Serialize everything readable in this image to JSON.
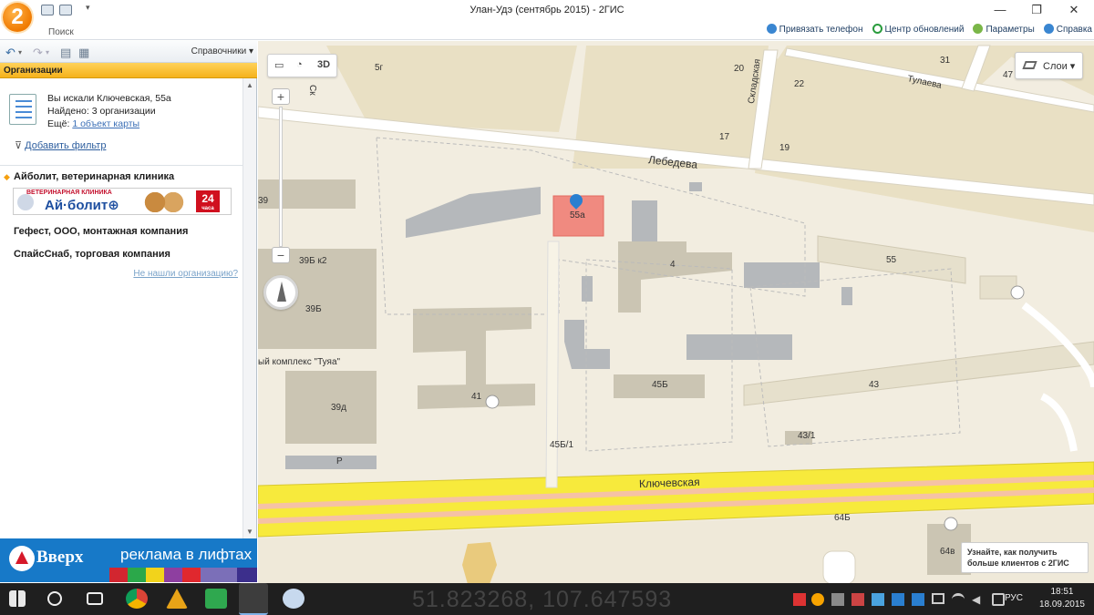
{
  "window": {
    "title": "Улан-Удэ (сентябрь 2015) - 2ГИС",
    "logo_text": "2",
    "search_tab": "Поиск",
    "minimize": "—",
    "restore": "❐",
    "close": "✕"
  },
  "top_links": {
    "link_phone": "Привязать телефон",
    "update_center": "Центр обновлений",
    "settings": "Параметры",
    "help": "Справка"
  },
  "left_panel": {
    "handbooks_label": "Справочники ▾",
    "section_title": "Организации",
    "search_info": {
      "query_line": "Вы искали Ключевская, 55а",
      "found_line": "Найдено: 3 организации",
      "more_prefix": "Ещё:",
      "more_link": "1 объект карты"
    },
    "add_filter": "Добавить фильтр",
    "organizations": [
      {
        "name": "Айболит, ветеринарная клиника"
      },
      {
        "name": "Гефест, ООО, монтажная компания"
      },
      {
        "name": "СпайсСнаб, торговая компания"
      }
    ],
    "banner": {
      "small_text": "ВЕТЕРИНАРНАЯ КЛИНИКА",
      "big_text": "Ай·болит⊕",
      "hours": "24",
      "hours_unit": "часа"
    },
    "not_found_link": "Не нашли организацию?"
  },
  "ad": {
    "brand": "Вверх",
    "text": "реклама в лифтах"
  },
  "map": {
    "tools": {
      "ruler": "▭",
      "spiral": "◔",
      "mode_3d": "3D"
    },
    "zoom_in": "+",
    "zoom_out": "−",
    "layers_label": "Слои ▾",
    "marker_label": "55а",
    "labels": {
      "b5g": "5г",
      "b20": "20",
      "b31": "31",
      "b22": "22",
      "b47": "47",
      "b17": "17",
      "b19": "19",
      "b39": "39",
      "b39b2": "39Б к2",
      "b39b": "39Б",
      "b4": "4",
      "b55": "55",
      "b41": "41",
      "b45b": "45Б",
      "b39d": "39д",
      "b43": "43",
      "b43_1": "43/1",
      "b45b1": "45Б/1",
      "b64b": "64Б",
      "b64v": "64в",
      "st_lebedeva": "Лебедева",
      "st_tulaeva": "Тулаева",
      "st_skladskaya": "Складская",
      "st_klyuchevskaya": "Ключевская",
      "st_short": "Ск",
      "mall": "ый комплекс \"Туяа\"",
      "p1": "Р"
    },
    "promo": "Узнайте, как получить больше клиентов с 2ГИС",
    "colors": {
      "road_main": "#f7ea3c",
      "building": "#cbc5b3",
      "building_gray": "#b5b8bb",
      "ground": "#f2ede0",
      "block": "#e7dec3",
      "highlight": "#f08a80"
    }
  },
  "taskbar": {
    "coords": "51.823268, 107.647593",
    "lang": "РУС",
    "time": "18:51",
    "date": "18.09.2015"
  }
}
